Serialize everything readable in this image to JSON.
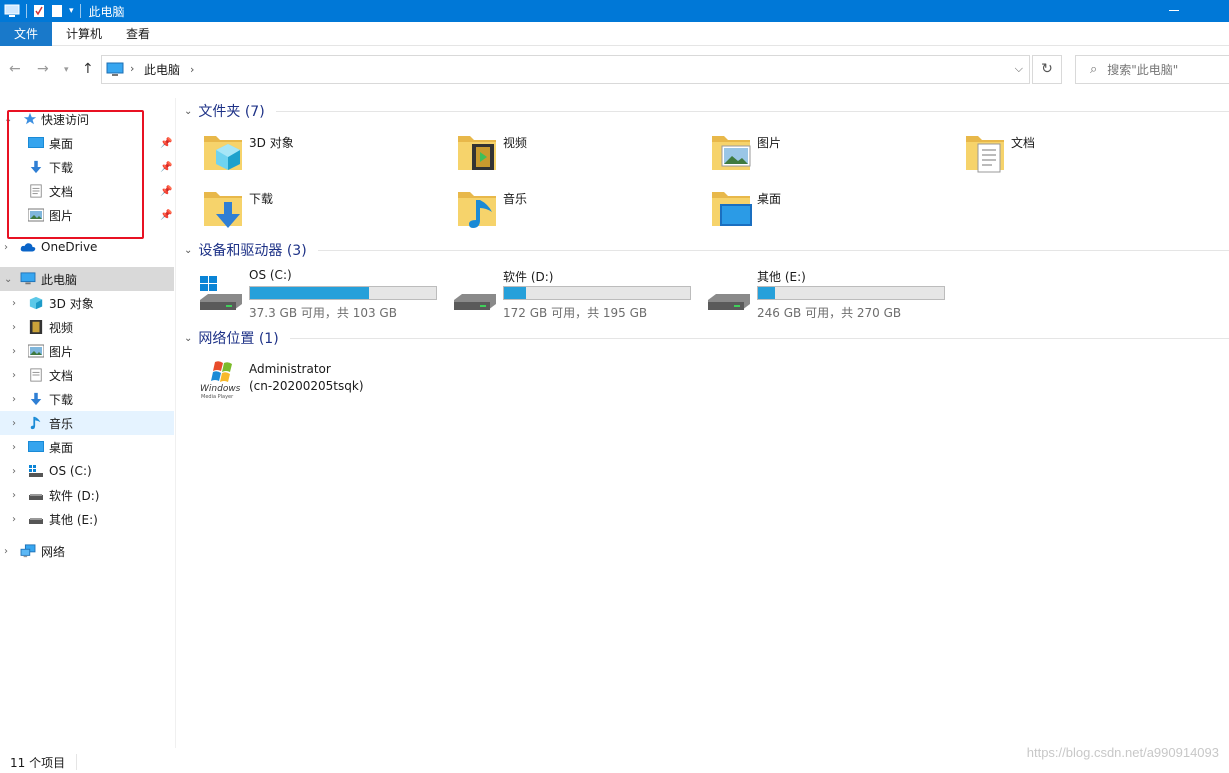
{
  "window": {
    "title": "此电脑"
  },
  "ribbon": {
    "tabs": [
      "文件",
      "计算机",
      "查看"
    ]
  },
  "address": {
    "crumb": "此电脑"
  },
  "search": {
    "placeholder": "搜索\"此电脑\""
  },
  "nav": {
    "quick_access": "快速访问",
    "quick_items": [
      "桌面",
      "下载",
      "文档",
      "图片"
    ],
    "onedrive": "OneDrive",
    "this_pc": "此电脑",
    "pc_items": [
      "3D 对象",
      "视频",
      "图片",
      "文档",
      "下载",
      "音乐",
      "桌面",
      "OS (C:)",
      "软件 (D:)",
      "其他 (E:)"
    ],
    "network": "网络"
  },
  "content": {
    "folders_header": "文件夹 (7)",
    "folders": [
      "3D 对象",
      "视频",
      "图片",
      "文档",
      "下载",
      "音乐",
      "桌面"
    ],
    "drives_header": "设备和驱动器 (3)",
    "drives": [
      {
        "name": "OS (C:)",
        "info": "37.3 GB 可用，共 103 GB",
        "used_fraction": 0.64
      },
      {
        "name": "软件 (D:)",
        "info": "172 GB 可用，共 195 GB",
        "used_fraction": 0.12
      },
      {
        "name": "其他 (E:)",
        "info": "246 GB 可用，共 270 GB",
        "used_fraction": 0.09
      }
    ],
    "network_header": "网络位置 (1)",
    "network_item": {
      "line1": "Administrator",
      "line2": "(cn-20200205tsqk)",
      "logo_text": "Windows Media Player"
    }
  },
  "status": {
    "items": "11 个项目"
  },
  "watermark": "https://blog.csdn.net/a990914093",
  "colors": {
    "titlebar": "#0078d7",
    "accent": "#26a0da",
    "highlight_box": "#e81123",
    "group_header": "#1e3287"
  }
}
